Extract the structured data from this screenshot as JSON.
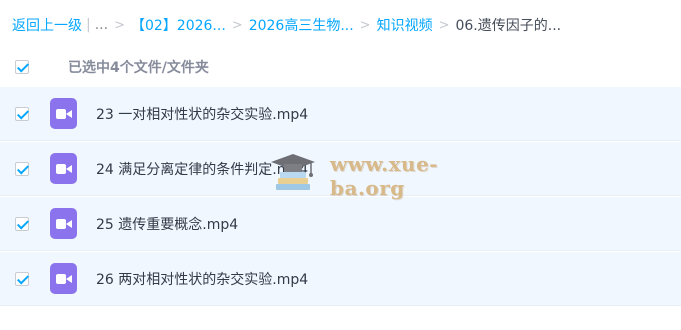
{
  "breadcrumb": {
    "back": "返回上一级",
    "ellipsis": "...",
    "items": [
      "【02】2026...",
      "2026高三生物...",
      "知识视频"
    ],
    "current": "06.遗传因子的..."
  },
  "selection": {
    "label": "已选中4个文件/文件夹",
    "checked": true
  },
  "files": [
    {
      "name": "23 一对相对性状的杂交实验.mp4",
      "icon": "video-file-icon",
      "checked": true
    },
    {
      "name": "24 满足分离定律的条件判定.mp4",
      "icon": "video-file-icon",
      "checked": true
    },
    {
      "name": "25 遗传重要概念.mp4",
      "icon": "video-file-icon",
      "checked": true
    },
    {
      "name": "26 两对相对性状的杂交实验.mp4",
      "icon": "video-file-icon",
      "checked": true
    }
  ],
  "watermark": {
    "text": "www.xue-ba.org",
    "icon": "graduation-cap-books-icon"
  },
  "colors": {
    "link": "#06a7ff",
    "row_bg": "#f0f7ff",
    "file_icon": "#8a73ec",
    "watermark_text": "#d8b98a"
  }
}
